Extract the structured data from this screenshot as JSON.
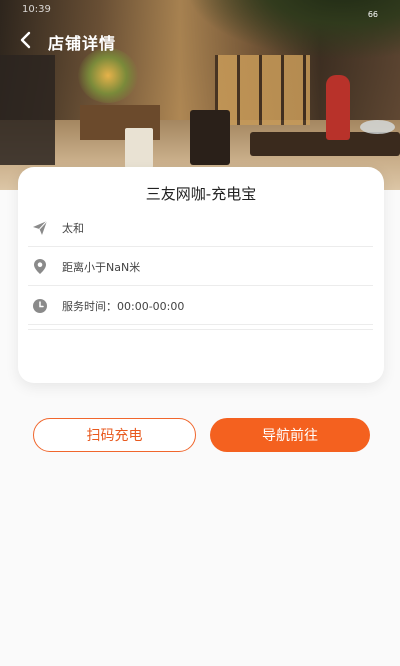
{
  "status_bar": {
    "time": "10:39",
    "battery": "66"
  },
  "header": {
    "title": "店铺详情"
  },
  "store": {
    "name": "三友网咖-充电宝",
    "address": "太和",
    "distance": "距离小于NaN米",
    "hours": "服务时间：00:00-00:00"
  },
  "buttons": {
    "scan_label": "扫码充电",
    "navigate_label": "导航前往"
  },
  "colors": {
    "accent": "#f4611f",
    "accent_outline": "#f0662c",
    "icon_gray": "#8a8a8a"
  }
}
